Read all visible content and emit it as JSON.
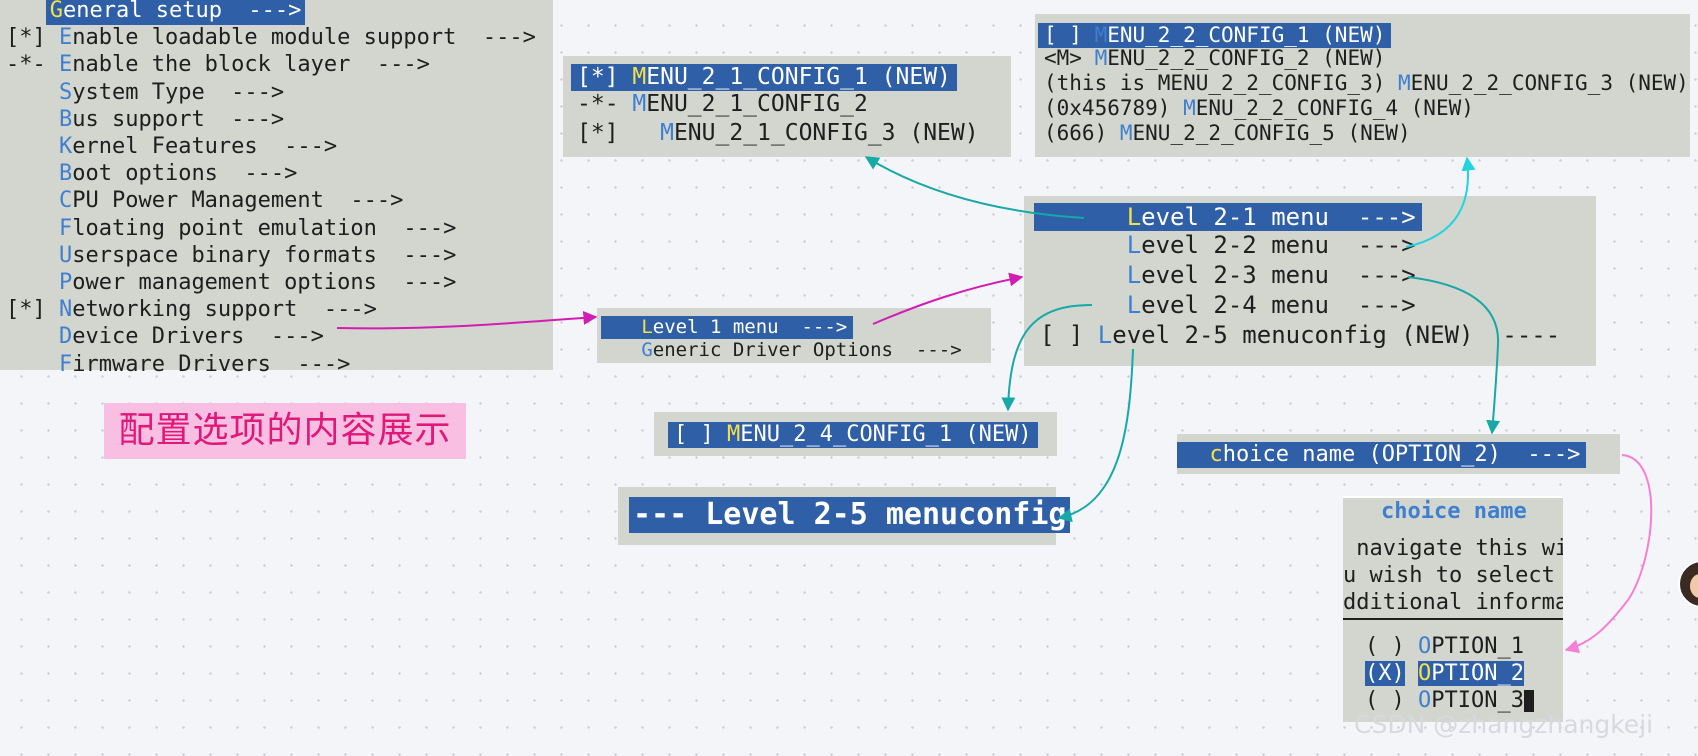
{
  "main_menu": {
    "items": [
      {
        "prefix": "   ",
        "hotkey": "G",
        "rest": "eneral setup  --->",
        "selected": true
      },
      {
        "prefix": "[*] ",
        "hotkey": "E",
        "rest": "nable loadable module support  --->"
      },
      {
        "prefix": "-*- ",
        "hotkey": "E",
        "rest": "nable the block layer  --->"
      },
      {
        "prefix": "    ",
        "hotkey": "S",
        "rest": "ystem Type  --->"
      },
      {
        "prefix": "    ",
        "hotkey": "B",
        "rest": "us support  --->"
      },
      {
        "prefix": "    ",
        "hotkey": "K",
        "rest": "ernel Features  --->"
      },
      {
        "prefix": "    ",
        "hotkey": "B",
        "rest": "oot options  --->"
      },
      {
        "prefix": "    ",
        "hotkey": "C",
        "rest": "PU Power Management  --->"
      },
      {
        "prefix": "    ",
        "hotkey": "F",
        "rest": "loating point emulation  --->"
      },
      {
        "prefix": "    ",
        "hotkey": "U",
        "rest": "serspace binary formats  --->"
      },
      {
        "prefix": "    ",
        "hotkey": "P",
        "rest": "ower management options  --->"
      },
      {
        "prefix": "[*] ",
        "hotkey": "N",
        "rest": "etworking support  --->"
      },
      {
        "prefix": "    ",
        "hotkey": "D",
        "rest": "evice Drivers  --->"
      },
      {
        "prefix": "    ",
        "hotkey": "F",
        "rest": "irmware Drivers  --->"
      }
    ]
  },
  "device_drivers_menu": {
    "items": [
      {
        "prefix": "   ",
        "hotkey": "L",
        "rest": "evel 1 menu  --->",
        "selected": true
      },
      {
        "prefix": "   ",
        "hotkey": "G",
        "rest": "eneric Driver Options  --->"
      }
    ]
  },
  "menu_2_1": {
    "items": [
      {
        "prefix": "[*] ",
        "hotkey": "M",
        "rest": "ENU_2_1_CONFIG_1 (NEW)",
        "selected": true
      },
      {
        "prefix": "-*- ",
        "hotkey": "M",
        "rest": "ENU_2_1_CONFIG_2"
      },
      {
        "prefix": "[*]   ",
        "hotkey": "M",
        "rest": "ENU_2_1_CONFIG_3 (NEW)"
      }
    ]
  },
  "menu_2_2": {
    "items": [
      {
        "prefix": "[ ] ",
        "hotkey": "M",
        "rest": "ENU_2_2_CONFIG_1 (NEW)",
        "selected": true
      },
      {
        "prefix": "<M> ",
        "hotkey": "M",
        "rest": "ENU_2_2_CONFIG_2 (NEW)"
      },
      {
        "prefix": "(this is MENU_2_2_CONFIG_3) ",
        "hotkey": "M",
        "rest": "ENU_2_2_CONFIG_3 (NEW)"
      },
      {
        "prefix": "(0x456789) ",
        "hotkey": "M",
        "rest": "ENU_2_2_CONFIG_4 (NEW)"
      },
      {
        "prefix": "(666) ",
        "hotkey": "M",
        "rest": "ENU_2_2_CONFIG_5 (NEW)"
      }
    ]
  },
  "level1_menu": {
    "items": [
      {
        "prefix": "      ",
        "hotkey": "L",
        "rest": "evel 2-1 menu  --->",
        "selected": true
      },
      {
        "prefix": "      ",
        "hotkey": "L",
        "rest": "evel 2-2 menu  --->"
      },
      {
        "prefix": "      ",
        "hotkey": "L",
        "rest": "evel 2-3 menu  --->"
      },
      {
        "prefix": "      ",
        "hotkey": "L",
        "rest": "evel 2-4 menu  --->"
      },
      {
        "prefix": "[ ] ",
        "hotkey": "L",
        "rest": "evel 2-5 menuconfig (NEW)  ----"
      }
    ]
  },
  "menu_2_4": {
    "items": [
      {
        "prefix": "[ ] ",
        "hotkey": "M",
        "rest": "ENU_2_4_CONFIG_1 (NEW)",
        "selected": true
      }
    ]
  },
  "menu_2_5": {
    "title": "--- Level 2-5 menuconfig"
  },
  "menu_2_3": {
    "items": [
      {
        "prefix": "  ",
        "hotkey": "c",
        "rest": "hoice name (OPTION_2)  --->",
        "selected": true
      }
    ]
  },
  "choice_dialog": {
    "title": "choice name",
    "help_lines": [
      " navigate this wi",
      "u wish to select ",
      "dditional informa"
    ],
    "options": [
      {
        "mark": "( )",
        "hotkey": "O",
        "rest": "PTION_1"
      },
      {
        "mark": "(X)",
        "hotkey": "O",
        "rest": "PTION_2",
        "selected": true
      },
      {
        "mark": "( )",
        "hotkey": "O",
        "rest": "PTION_3",
        "cursor": true
      }
    ]
  },
  "caption": "配置选项的内容展示",
  "watermark": "CSDN @zhangzhangkeji",
  "colors": {
    "panel_bg": "#d3d6ce",
    "selection_bg": "#2f5fa6",
    "hotkey_blue": "#3f7fd0",
    "hotkey_yellow": "#f4e04d",
    "arrow_magenta": "#d21cb3",
    "arrow_teal": "#17a8a8",
    "arrow_cyan": "#22d3e0",
    "arrow_pink": "#f57fd6",
    "caption_bg": "#f9bfe3",
    "caption_text": "#e0187a"
  }
}
